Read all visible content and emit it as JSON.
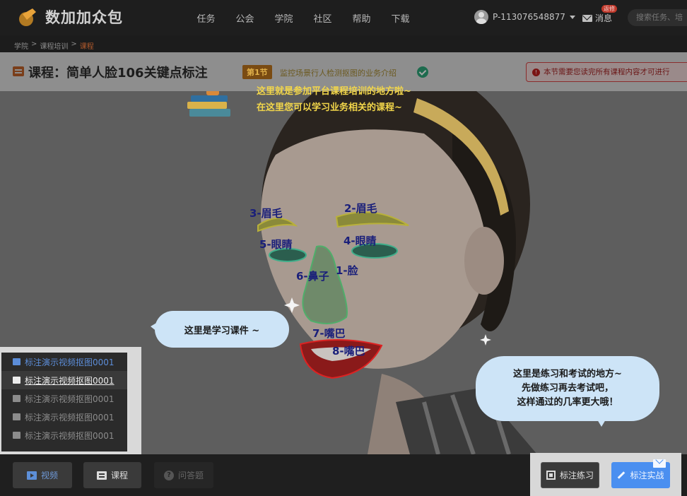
{
  "brand": {
    "name": "数加加众包"
  },
  "nav": {
    "items": [
      "任务",
      "公会",
      "学院",
      "社区",
      "帮助",
      "下载"
    ]
  },
  "user": {
    "id": "P-113076548877"
  },
  "messages": {
    "label": "消息",
    "badge": "返修"
  },
  "search": {
    "placeholder": "搜索任务、培"
  },
  "breadcrumb": [
    "学院",
    ">",
    "课程培训",
    ">",
    "课程"
  ],
  "course": {
    "title": "课程：简单人脸106关键点标注",
    "section_tag": "第1节",
    "section_title": "监控场景行人检测抠图的业务介绍"
  },
  "notice": {
    "text": "本节需要您读完所有课程内容才可进行"
  },
  "guide": {
    "top_line1": "这里就是参加平台课程培训的地方啦~",
    "top_line2": "在这里您可以学习业务相关的课程~",
    "courseware": "这里是学习课件 ~",
    "practice_line1": "这里是练习和考试的地方~",
    "practice_line2": "先做练习再去考试吧，",
    "practice_line3": "这样通过的几率更大哦！"
  },
  "face_labels": [
    "3-眉毛",
    "2-眉毛",
    "5-眼睛",
    "4-眼睛",
    "6-鼻子",
    "1-脸",
    "7-嘴巴",
    "8-嘴巴"
  ],
  "courseware_list": [
    {
      "label": "标注演示视频抠图0001",
      "state": "active"
    },
    {
      "label": "标注演示视频抠图0001",
      "state": "current"
    },
    {
      "label": "标注演示视频抠图0001",
      "state": "normal"
    },
    {
      "label": "标注演示视频抠图0001",
      "state": "normal"
    },
    {
      "label": "标注演示视频抠图0001",
      "state": "normal"
    }
  ],
  "bottom": {
    "video": "视频",
    "course": "课程",
    "qa": "问答题",
    "practice": "标注练习",
    "exam": "标注实战"
  },
  "colors": {
    "accent": "#4a8ff0",
    "guide_text": "#f2d64a",
    "bubble": "#cde4f7",
    "warning": "#7a1414"
  }
}
